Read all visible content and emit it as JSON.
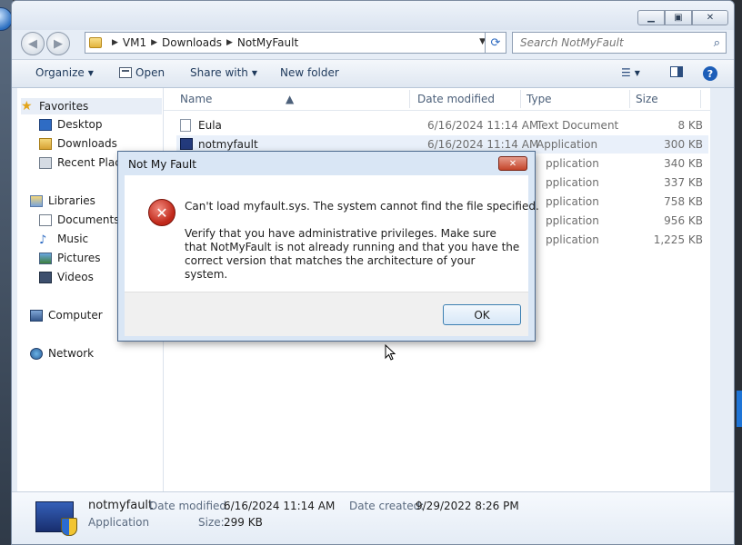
{
  "explorer": {
    "address": {
      "crumbs": [
        "VM1",
        "Downloads",
        "NotMyFault"
      ]
    },
    "search": {
      "placeholder": "Search NotMyFault"
    },
    "toolbar": {
      "organize": "Organize",
      "open": "Open",
      "share_with": "Share with",
      "new_folder": "New folder"
    },
    "nav": {
      "favorites": "Favorites",
      "desktop": "Desktop",
      "downloads": "Downloads",
      "recent_places": "Recent Plac",
      "libraries": "Libraries",
      "documents": "Documents",
      "music": "Music",
      "pictures": "Pictures",
      "videos": "Videos",
      "computer": "Computer",
      "network": "Network"
    },
    "columns": {
      "name": "Name",
      "date": "Date modified",
      "type": "Type",
      "size": "Size"
    },
    "files": [
      {
        "name": "Eula",
        "date": "6/16/2024 11:14 AM",
        "type": "Text Document",
        "size": "8 KB",
        "icon": "text-document-icon"
      },
      {
        "name": "notmyfault",
        "date": "6/16/2024 11:14 AM",
        "type": "Application",
        "size": "300 KB",
        "icon": "application-icon"
      },
      {
        "name": "",
        "date": "",
        "type": "pplication",
        "size": "340 KB",
        "icon": ""
      },
      {
        "name": "",
        "date": "",
        "type": "pplication",
        "size": "337 KB",
        "icon": ""
      },
      {
        "name": "",
        "date": "",
        "type": "pplication",
        "size": "758 KB",
        "icon": ""
      },
      {
        "name": "",
        "date": "",
        "type": "pplication",
        "size": "956 KB",
        "icon": ""
      },
      {
        "name": "",
        "date": "",
        "type": "pplication",
        "size": "1,225 KB",
        "icon": ""
      }
    ],
    "details": {
      "name": "notmyfault",
      "kind": "Application",
      "date_modified_label": "Date modified:",
      "date_modified": "6/16/2024 11:14 AM",
      "date_created_label": "Date created:",
      "date_created": "9/29/2022 8:26 PM",
      "size_label": "Size:",
      "size": "299 KB"
    }
  },
  "dialog": {
    "title": "Not My Fault",
    "message": "Can't load myfault.sys. The system cannot find the file specified.",
    "detail": "Verify that you have administrative privileges. Make sure that NotMyFault is not already running and that you have the correct version that matches the architecture of your system.",
    "ok_label": "OK"
  }
}
